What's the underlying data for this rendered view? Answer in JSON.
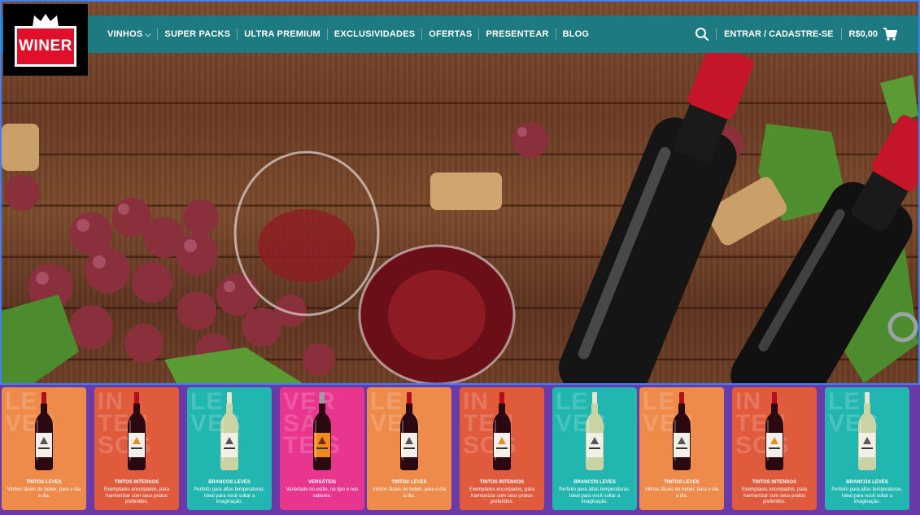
{
  "logo": {
    "text": "WINER",
    "brand_color": "#e0102a"
  },
  "nav": {
    "items": [
      {
        "label": "VINHOS",
        "has_dropdown": true
      },
      {
        "label": "SUPER PACKS"
      },
      {
        "label": "ULTRA PREMIUM"
      },
      {
        "label": "EXCLUSIVIDADES"
      },
      {
        "label": "OFERTAS"
      },
      {
        "label": "PRESENTEAR"
      },
      {
        "label": "BLOG"
      }
    ],
    "login_label": "ENTRAR / CADASTRE-SE",
    "cart_total": "R$0,00",
    "search_icon": "search-icon",
    "cart_icon": "cart-icon",
    "bar_color": "#1d7a80"
  },
  "cards": [
    {
      "title": "TINTOS LEVES",
      "desc": "Vinhos fáceis de beber, para o dia a dia.",
      "bg_word": "LE\nVES",
      "color": "#ee8a4a",
      "bottle": "red"
    },
    {
      "title": "TINTOS INTENSOS",
      "desc": "Exemplares encorpados, para harmonizar com seus pratos preferidos.",
      "bg_word": "IN\nTEN\nSOS",
      "color": "#e05a3c",
      "bottle": "red-orange"
    },
    {
      "title": "BRANCOS LEVES",
      "desc": "Perfeito para altas temperaturas. Ideal para você soltar a imaginação.",
      "bg_word": "LE\nVES",
      "color": "#22b6b0",
      "bottle": "white"
    },
    {
      "title": "VERSÁTEIS",
      "desc": "Variedade no estilo, no tipo e nos sabores.",
      "bg_word": "VER\nSÁ\nTEIS",
      "color": "#e8358e",
      "bottle": "orange"
    },
    {
      "title": "TINTOS LEVES",
      "desc": "Vinhos fáceis de beber, para o dia a dia.",
      "bg_word": "LE\nVES",
      "color": "#ee8a4a",
      "bottle": "red"
    },
    {
      "title": "TINTOS INTENSOS",
      "desc": "Exemplares encorpados, para harmonizar com seus pratos preferidos.",
      "bg_word": "IN\nTEN\nSOS",
      "color": "#e05a3c",
      "bottle": "red-orange"
    },
    {
      "title": "BRANCOS LEVES",
      "desc": "Perfeito para altas temperaturas. Ideal para você soltar a imaginação.",
      "bg_word": "LE\nVES",
      "color": "#22b6b0",
      "bottle": "white"
    },
    {
      "title": "TINTOS LEVES",
      "desc": "Vinhos fáceis de beber, para o dia a dia.",
      "bg_word": "LE\nVES",
      "color": "#ee8a4a",
      "bottle": "red"
    },
    {
      "title": "TINTOS INTENSOS",
      "desc": "Exemplares encorpados, para harmonizar com seus pratos preferidos.",
      "bg_word": "IN\nTEN\nSOS",
      "color": "#e05a3c",
      "bottle": "red-orange"
    },
    {
      "title": "BRANCOS LEVES",
      "desc": "Perfeito para altas temperaturas. Ideal para você soltar a imaginação.",
      "bg_word": "LE\nVES",
      "color": "#22b6b0",
      "bottle": "white"
    }
  ]
}
